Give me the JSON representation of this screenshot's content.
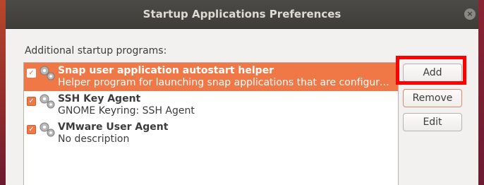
{
  "window": {
    "title": "Startup Applications Preferences",
    "close_icon": "close-icon"
  },
  "section_label": "Additional startup programs:",
  "programs": [
    {
      "checked": true,
      "selected": true,
      "name": "Snap user application autostart helper",
      "description": "Helper program for launching snap applications that are configured t…",
      "icon": "gears-icon"
    },
    {
      "checked": true,
      "selected": false,
      "name": "SSH Key Agent",
      "description": "GNOME Keyring: SSH Agent",
      "icon": "gears-icon"
    },
    {
      "checked": true,
      "selected": false,
      "name": "VMware User Agent",
      "description": "No description",
      "icon": "gears-icon"
    }
  ],
  "buttons": {
    "add": "Add",
    "remove": "Remove",
    "edit": "Edit"
  },
  "colors": {
    "selection": "#f07746",
    "highlight": "#ff0000",
    "titlebar": "#3e3d39"
  }
}
